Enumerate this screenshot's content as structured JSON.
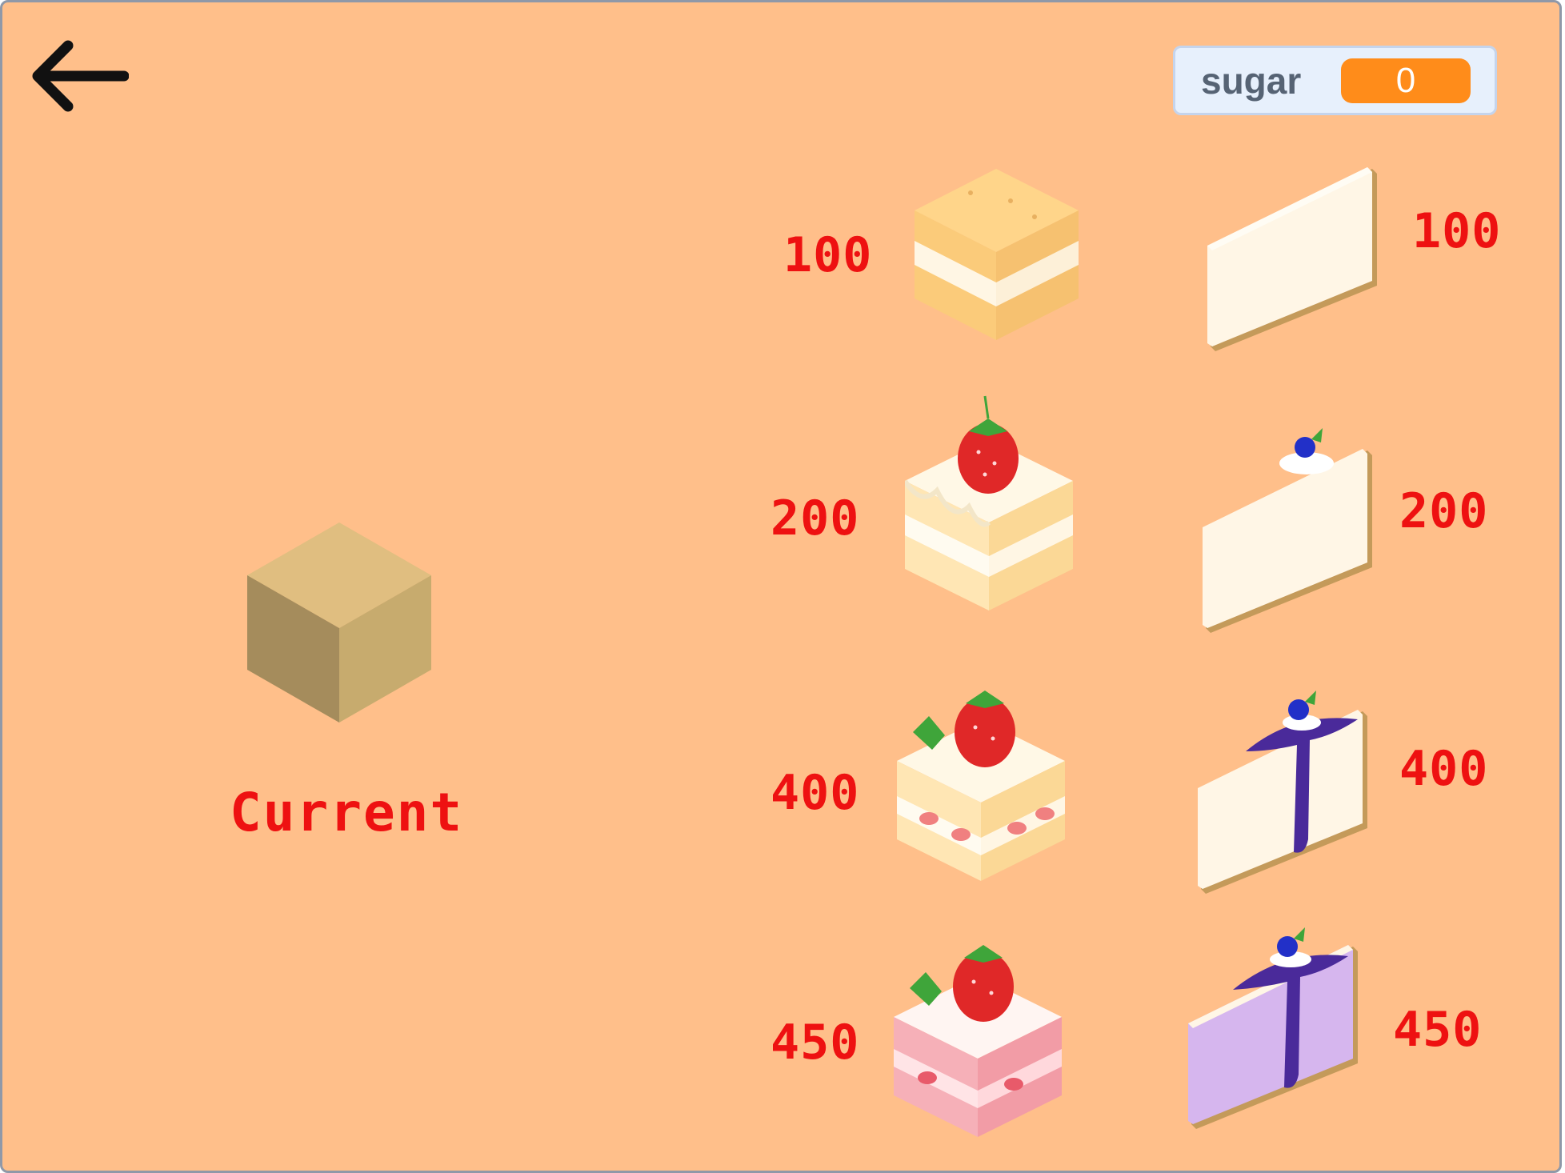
{
  "topbar": {
    "back_icon": "arrow-left-icon",
    "sugar_monitor": {
      "label": "sugar",
      "value": "0"
    }
  },
  "current": {
    "label": "Current",
    "icon": "sugar-cube-icon"
  },
  "shop": {
    "square_cakes": [
      {
        "price": "100",
        "icon": "plain-sponge-cake-icon"
      },
      {
        "price": "200",
        "icon": "strawberry-cream-cake-icon"
      },
      {
        "price": "400",
        "icon": "strawberry-shortcake-icon"
      },
      {
        "price": "450",
        "icon": "pink-strawberry-cake-icon"
      }
    ],
    "cheesecakes": [
      {
        "price": "100",
        "icon": "plain-cheesecake-icon"
      },
      {
        "price": "200",
        "icon": "blueberry-cheesecake-icon"
      },
      {
        "price": "400",
        "icon": "blueberry-sauce-cheesecake-icon"
      },
      {
        "price": "450",
        "icon": "lavender-blueberry-cheesecake-icon"
      }
    ]
  },
  "colors": {
    "background": "#FFBF8A",
    "price_text": "#EE1111",
    "monitor_value": "#FF8C1A",
    "monitor_bg": "#E7F0FC"
  }
}
